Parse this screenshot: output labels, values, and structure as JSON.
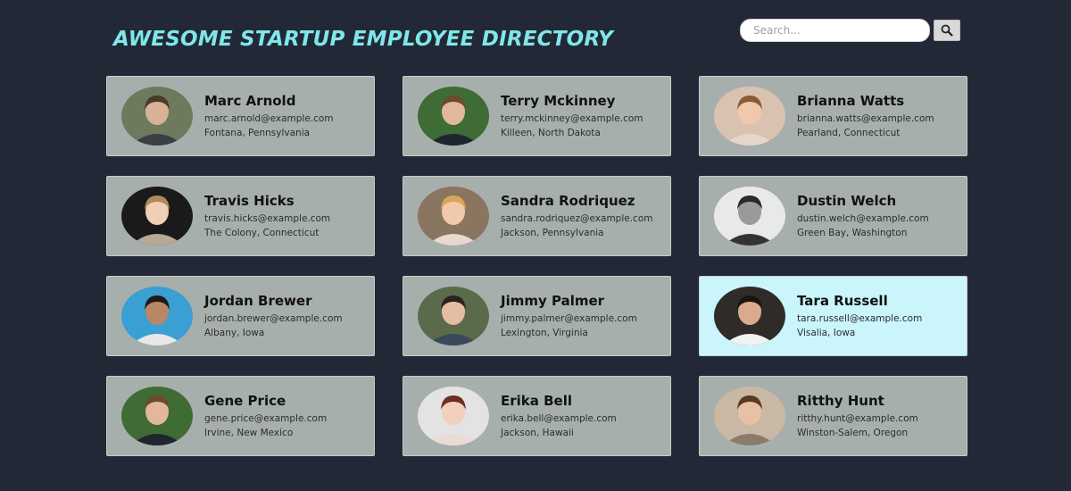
{
  "header": {
    "title": "AWESOME STARTUP EMPLOYEE DIRECTORY"
  },
  "search": {
    "placeholder": "Search...",
    "value": "",
    "button_icon": "magnifier-icon"
  },
  "employees": [
    {
      "name": "Marc Arnold",
      "email": "marc.arnold@example.com",
      "location": "Fontana, Pennsylvania",
      "bg": "#6d7a5e",
      "skin": "#d8b197",
      "hair": "#4a3a2a",
      "shirt": "#3b3f44"
    },
    {
      "name": "Terry Mckinney",
      "email": "terry.mckinney@example.com",
      "location": "Killeen, North Dakota",
      "bg": "#3f6b34",
      "skin": "#e2b79b",
      "hair": "#6b4a2e",
      "shirt": "#1f2630"
    },
    {
      "name": "Brianna Watts",
      "email": "brianna.watts@example.com",
      "location": "Pearland, Connecticut",
      "bg": "#d9c3b0",
      "skin": "#f0c8ab",
      "hair": "#8a5b34",
      "shirt": "#e7d6c8"
    },
    {
      "name": "Travis Hicks",
      "email": "travis.hicks@example.com",
      "location": "The Colony, Connecticut",
      "bg": "#1a1a1a",
      "skin": "#f1cfb6",
      "hair": "#b08a5a",
      "shirt": "#b9a996"
    },
    {
      "name": "Sandra Rodriquez",
      "email": "sandra.rodriquez@example.com",
      "location": "Jackson, Pennsylvania",
      "bg": "#8a7560",
      "skin": "#f2c9ad",
      "hair": "#d9a65a",
      "shirt": "#e9d7d0"
    },
    {
      "name": "Dustin Welch",
      "email": "dustin.welch@example.com",
      "location": "Green Bay, Washington",
      "bg": "#e9e9e9",
      "skin": "#9a9a9a",
      "hair": "#2a2a2a",
      "shirt": "#333333"
    },
    {
      "name": "Jordan Brewer",
      "email": "jordan.brewer@example.com",
      "location": "Albany, Iowa",
      "bg": "#3a9fd2",
      "skin": "#b98666",
      "hair": "#1f1a16",
      "shirt": "#e8e8e8"
    },
    {
      "name": "Jimmy Palmer",
      "email": "jimmy.palmer@example.com",
      "location": "Lexington, Virginia",
      "bg": "#5a6b4c",
      "skin": "#e4bda2",
      "hair": "#2b2220",
      "shirt": "#3a4a5c"
    },
    {
      "name": "Tara Russell",
      "email": "tara.russell@example.com",
      "location": "Visalia, Iowa",
      "bg": "#2f2b29",
      "skin": "#d9ab8c",
      "hair": "#1c1613",
      "shirt": "#f2f2f2"
    },
    {
      "name": "Gene Price",
      "email": "gene.price@example.com",
      "location": "Irvine, New Mexico",
      "bg": "#3f6b34",
      "skin": "#e2b79b",
      "hair": "#6b4a2e",
      "shirt": "#1f2630"
    },
    {
      "name": "Erika Bell",
      "email": "erika.bell@example.com",
      "location": "Jackson, Hawaii",
      "bg": "#e3e3e3",
      "skin": "#f3cfbd",
      "hair": "#6a2e22",
      "shirt": "#e9dcd6"
    },
    {
      "name": "Ritthy Hunt",
      "email": "ritthy.hunt@example.com",
      "location": "Winston-Salem, Oregon",
      "bg": "#c9b9a4",
      "skin": "#e8c0a5",
      "hair": "#5a3a22",
      "shirt": "#8a7b6a"
    }
  ],
  "active_index": 8,
  "colors": {
    "background": "#232836",
    "title": "#7fe7ea",
    "card": "#a7afad",
    "card_active": "#c9f5fb"
  }
}
